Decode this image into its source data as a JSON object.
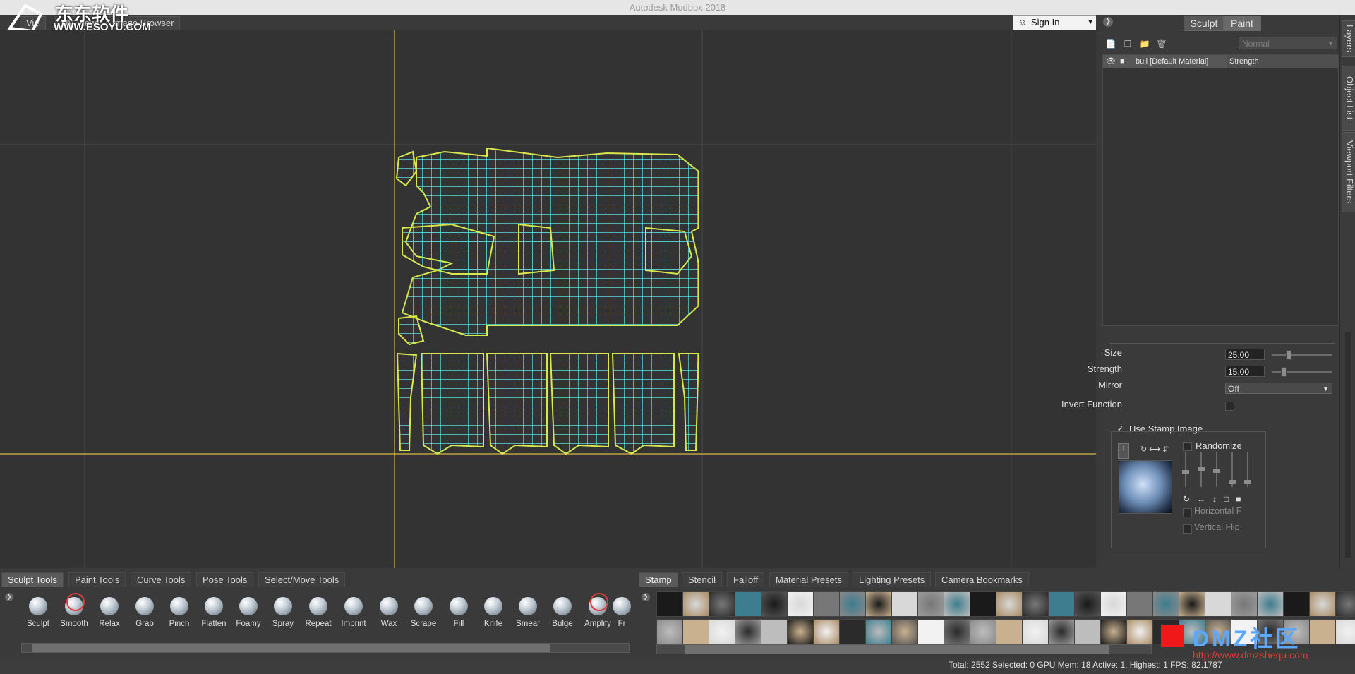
{
  "window": {
    "title": "Autodesk Mudbox 2018"
  },
  "watermark": {
    "site": "WWW.ESOYU.COM",
    "site_cn": "东东软件园",
    "dmz_title": "DMZ社区",
    "dmz_url": "http://www.dmzshequ.com"
  },
  "view_tabs": [
    "Vie",
    "UV View",
    "Image Browser"
  ],
  "signin": {
    "label": "Sign In"
  },
  "right_panel": {
    "mode_tabs": [
      "Sculpt",
      "Paint"
    ],
    "blend_mode": "Normal",
    "layer": {
      "name": "bull [Default Material]",
      "channel": "Strength"
    },
    "side_tabs": [
      "Layers",
      "Object List",
      "Viewport Filters"
    ],
    "properties": {
      "size_label": "Size",
      "size_value": "25.00",
      "strength_label": "Strength",
      "strength_value": "15.00",
      "mirror_label": "Mirror",
      "mirror_value": "Off",
      "invert_label": "Invert Function",
      "use_stamp_label": "Use Stamp Image",
      "randomize_label": "Randomize",
      "hflip_label": "Horizontal F",
      "vflip_label": "Vertical Flip"
    }
  },
  "tool_tabs": [
    "Sculpt Tools",
    "Paint Tools",
    "Curve Tools",
    "Pose Tools",
    "Select/Move Tools"
  ],
  "tools": [
    "Sculpt",
    "Smooth",
    "Relax",
    "Grab",
    "Pinch",
    "Flatten",
    "Foamy",
    "Spray",
    "Repeat",
    "Imprint",
    "Wax",
    "Scrape",
    "Fill",
    "Knife",
    "Smear",
    "Bulge",
    "Amplify",
    "Fr"
  ],
  "tray_tabs": [
    "Stamp",
    "Stencil",
    "Falloff",
    "Material Presets",
    "Lighting Presets",
    "Camera Bookmarks"
  ],
  "status": {
    "text": "Total: 2552   Selected: 0 GPU Mem: 18  Active: 1, Highest: 1   FPS: 82.1787"
  },
  "colors": {
    "uv_wire": "#5ce0e0",
    "uv_border": "#d8e84a",
    "axis": "#d8b74a",
    "accent_red": "#e23b3b"
  }
}
